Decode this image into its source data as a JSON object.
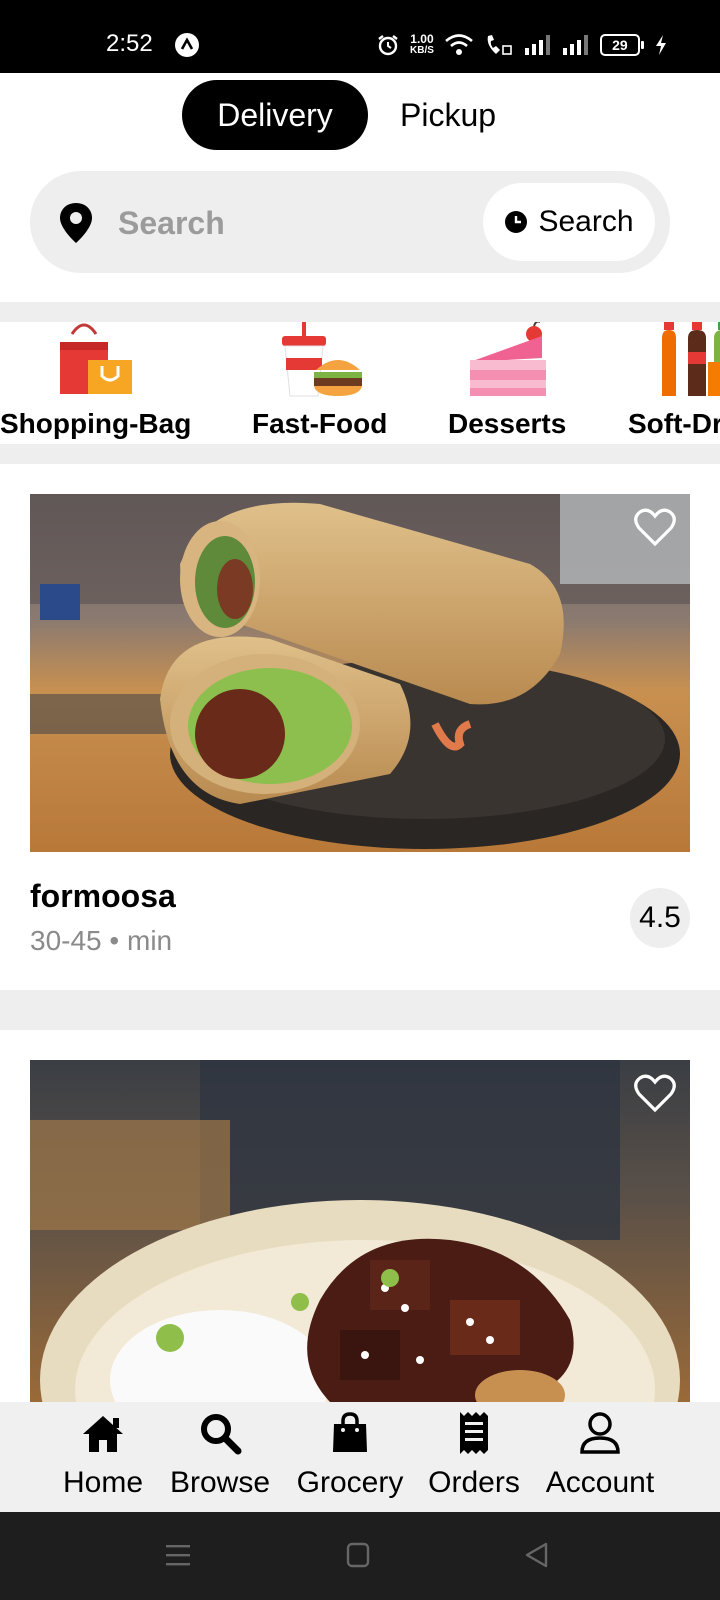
{
  "status_bar": {
    "time": "2:52",
    "net_speed_value": "1.00",
    "net_speed_unit": "KB/S",
    "battery": "29"
  },
  "mode_toggle": {
    "delivery_label": "Delivery",
    "pickup_label": "Pickup",
    "selected": "Delivery"
  },
  "search": {
    "placeholder": "Search",
    "value": "",
    "schedule_label": "Search"
  },
  "categories": [
    {
      "label": "Shopping-Bag",
      "icon": "shopping-bag-icon"
    },
    {
      "label": "Fast-Food",
      "icon": "fast-food-icon"
    },
    {
      "label": "Desserts",
      "icon": "desserts-icon"
    },
    {
      "label": "Soft-Drinks",
      "icon": "soft-drinks-icon"
    }
  ],
  "stores": [
    {
      "name": "formoosa",
      "time_range": "30-45",
      "time_unit": "min",
      "rating": "4.5",
      "image": "wrap-roll-photo"
    },
    {
      "name": "",
      "image": "braised-pork-rice-photo"
    }
  ],
  "bottom_nav": {
    "items": [
      {
        "label": "Home",
        "icon": "home-icon"
      },
      {
        "label": "Browse",
        "icon": "search-icon"
      },
      {
        "label": "Grocery",
        "icon": "bag-icon"
      },
      {
        "label": "Orders",
        "icon": "receipt-icon"
      },
      {
        "label": "Account",
        "icon": "user-icon"
      }
    ]
  },
  "colors": {
    "accent": "#000000",
    "background": "#ffffff",
    "surface": "#eeeeee",
    "muted_text": "#8a8a8a"
  }
}
